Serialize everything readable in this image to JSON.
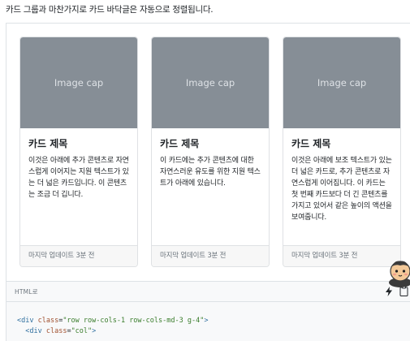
{
  "intro_text": "카드 그룹과 마찬가지로 카드 바닥글은 자동으로 정렬됩니다.",
  "cards": [
    {
      "image_label": "Image cap",
      "title": "카드 제목",
      "text": "이것은 아래에 추가 콘텐츠로 자연스럽게 이어지는 지원 텍스트가 있는 더 넓은 카드입니다. 이 콘텐츠는 조금 더 깁니다.",
      "footer": "마지막 업데이트 3분 전"
    },
    {
      "image_label": "Image cap",
      "title": "카드 제목",
      "text": "이 카드에는 추가 콘텐츠에 대한 자연스러운 유도를 위한 지원 텍스트가 아래에 있습니다.",
      "footer": "마지막 업데이트 3분 전"
    },
    {
      "image_label": "Image cap",
      "title": "카드 제목",
      "text": "이것은 아래에 보조 텍스트가 있는 더 넓은 카드로, 추가 콘텐츠로 자연스럽게 이어집니다. 이 카드는 첫 번째 카드보다 더 긴 콘텐츠를 가지고 있어서 같은 높이의 액션을 보여줍니다.",
      "footer": "마지막 업데이트 3분 전"
    }
  ],
  "code_block": {
    "language_label": "HTML로",
    "copy_icon": "clipboard-icon",
    "run_icon": "bolt-icon",
    "line1": {
      "open": "<div ",
      "attr": "class",
      "eq": "=",
      "val": "\"row row-cols-1 row-cols-md-3 g-4\"",
      "close": ">"
    },
    "line2": {
      "indent": "  ",
      "open": "<div ",
      "attr": "class",
      "eq": "=",
      "val": "\"col\"",
      "close": ">"
    }
  },
  "colors": {
    "image_placeholder": "#868e96",
    "card_footer_bg": "#f7f7f7",
    "code_bg": "#f8f9fa"
  }
}
